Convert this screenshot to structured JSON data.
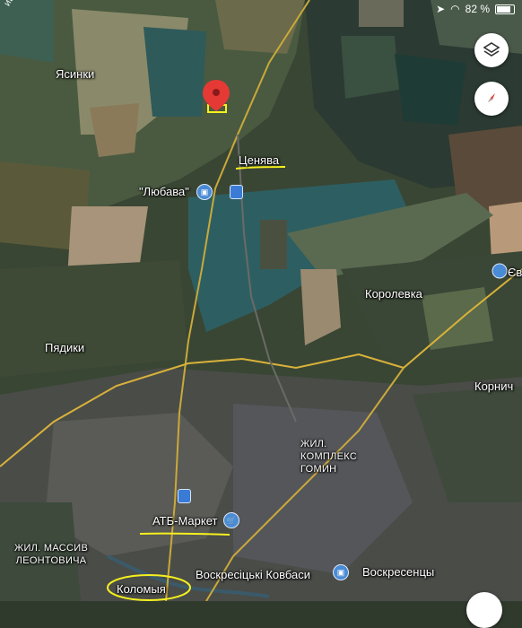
{
  "status_bar": {
    "battery_percent": "82 %",
    "partial_label": "ица Січ"
  },
  "map": {
    "labels": {
      "yasinki": "Ясинки",
      "tsenyava": "Ценява",
      "lyubava": "\"Любава\"",
      "korolevka": "Королевка",
      "pyadiki": "Пядики",
      "kornich": "Корнич",
      "zhil_gomin": "ЖИЛ.\nКОМПЛЕКС\nГОМИН",
      "atb": "АТБ-Маркет",
      "zhil_leontovicha": "ЖИЛ. МАССИВ\nЛЕОНТОВИЧА",
      "voskresenskie": "Воскресіцькі Ковбаси",
      "voskresentsy": "Воскресенцы",
      "kolomyia": "Коломыя",
      "edge_label": "Єв"
    },
    "colors": {
      "pin_red": "#e53935",
      "poi_blue": "#4a8bd6",
      "road_yellow": "#d9b23a",
      "highlight_yellow": "#f5f01e"
    }
  },
  "controls": {
    "layers": "layers-icon",
    "compass": "compass-icon"
  }
}
